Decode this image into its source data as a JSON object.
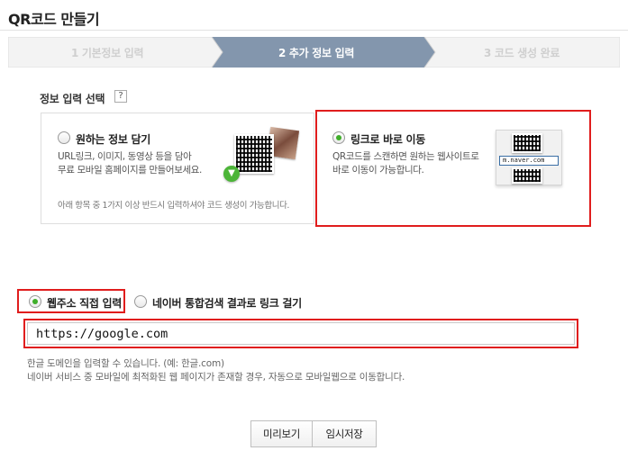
{
  "page": {
    "title": "QR코드 만들기"
  },
  "stepper": {
    "steps": [
      {
        "label": "1 기본정보 입력",
        "state": "done"
      },
      {
        "label": "2 추가 정보 입력",
        "state": "active"
      },
      {
        "label": "3 코드 생성 완료",
        "state": "pending"
      }
    ],
    "active_color": "#7f93ab"
  },
  "info_select": {
    "label": "정보 입력 선택",
    "help": "?",
    "options": [
      {
        "title": "원하는 정보 담기",
        "selected": false,
        "desc_line1": "URL링크, 이미지, 동영상 등을 담아",
        "desc_line2": "무료 모바일 홈페이지를 만들어보세요.",
        "note": "아래 항목 중 1가지 이상 반드시 입력하셔야 코드 생성이 가능합니다."
      },
      {
        "title": "링크로 바로 이동",
        "selected": true,
        "desc_line1": "QR코드를 스캔하면 원하는 웹사이트로",
        "desc_line2": "바로 이동이 가능합니다.",
        "illustration_url": "m.naver.com"
      }
    ]
  },
  "link": {
    "options": [
      {
        "label": "웹주소 직접 입력",
        "selected": true
      },
      {
        "label": "네이버 통합검색 결과로 링크 걸기",
        "selected": false
      }
    ],
    "url_value": "https://google.com",
    "hint_line1": "한글 도메인을 입력할 수 있습니다. (예: 한글.com)",
    "hint_line2": "네이버 서비스 중 모바일에 최적화된 웹 페이지가 존재할 경우, 자동으로 모바일웹으로 이동합니다."
  },
  "buttons": {
    "preview": "미리보기",
    "save_draft": "임시저장"
  },
  "colors": {
    "highlight": "#e01d1d",
    "radio_on": "#3fae2a"
  }
}
